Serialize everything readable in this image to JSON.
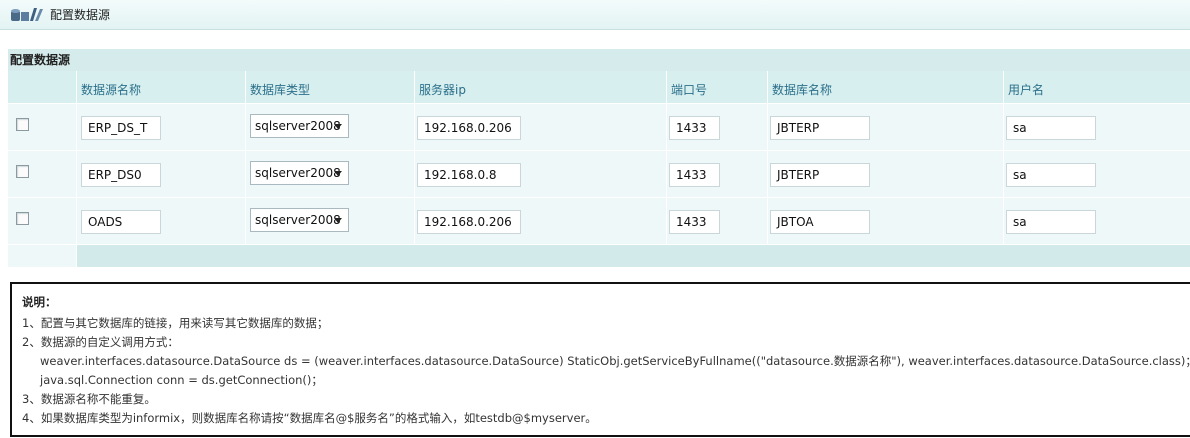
{
  "titlebar": {
    "title": "配置数据源"
  },
  "section": {
    "heading": "配置数据源"
  },
  "columns": {
    "name": "数据源名称",
    "type": "数据库类型",
    "ip": "服务器ip",
    "port": "端口号",
    "db": "数据库名称",
    "user": "用户名"
  },
  "rows": [
    {
      "checked": false,
      "name": "ERP_DS_T",
      "type": "sqlserver2008",
      "ip": "192.168.0.206",
      "port": "1433",
      "db": "JBTERP",
      "user": "sa"
    },
    {
      "checked": false,
      "name": "ERP_DS0",
      "type": "sqlserver2008",
      "ip": "192.168.0.8",
      "port": "1433",
      "db": "JBTERP",
      "user": "sa"
    },
    {
      "checked": false,
      "name": "OADS",
      "type": "sqlserver2008",
      "ip": "192.168.0.206",
      "port": "1433",
      "db": "JBTOA",
      "user": "sa"
    }
  ],
  "notes": {
    "title": "说明：",
    "lines": [
      "1、配置与其它数据库的链接，用来读写其它数据库的数据；",
      "2、数据源的自定义调用方式：",
      "weaver.interfaces.datasource.DataSource ds = (weaver.interfaces.datasource.DataSource) StaticObj.getServiceByFullname((\"datasource.数据源名称\"), weaver.interfaces.datasource.DataSource.class)；",
      "java.sql.Connection conn = ds.getConnection()；",
      "3、数据源名称不能重复。",
      "4、如果数据库类型为informix，则数据库名称请按“数据库名@$服务名”的格式输入，如testdb@$myserver。"
    ]
  }
}
